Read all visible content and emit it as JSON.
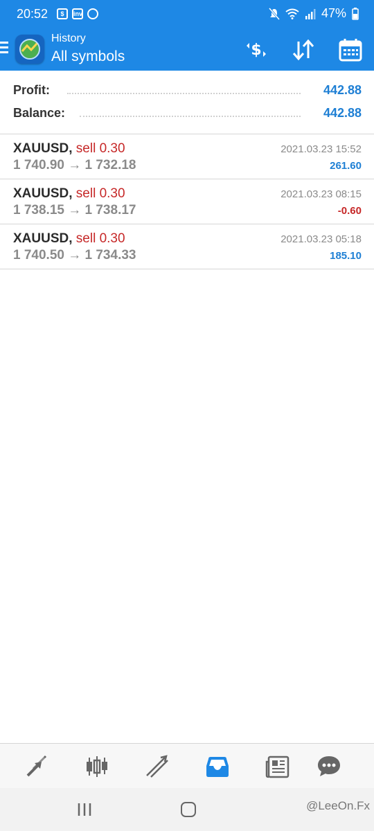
{
  "status_bar": {
    "time": "20:52",
    "battery": "47%",
    "notification_icons": [
      "shopee-icon",
      "investing-icon",
      "whatsapp-icon"
    ],
    "notification_badges": [
      "$",
      "inv",
      ""
    ]
  },
  "app_bar": {
    "subtitle": "History",
    "title": "All symbols",
    "actions": [
      "deposit-swap-icon",
      "sort-icon",
      "calendar-icon"
    ],
    "color": "#1e88e5"
  },
  "summary": {
    "profit_label": "Profit:",
    "profit_value": "442.88",
    "balance_label": "Balance:",
    "balance_value": "442.88"
  },
  "trades": [
    {
      "symbol": "XAUUSD,",
      "side": "sell 0.30",
      "prices": "1 740.90 → 1 732.18",
      "datetime": "2021.03.23 15:52",
      "pl": "261.60"
    },
    {
      "symbol": "XAUUSD,",
      "side": "sell 0.30",
      "prices": "1 738.15 → 1 738.17",
      "datetime": "2021.03.23 08:15",
      "pl": "-0.60"
    },
    {
      "symbol": "XAUUSD,",
      "side": "sell 0.30",
      "prices": "1 740.50 → 1 734.33",
      "datetime": "2021.03.23 05:18",
      "pl": "185.10"
    }
  ],
  "bottom_nav": [
    "quotes-icon",
    "chart-icon",
    "trade-icon",
    "history-icon",
    "news-icon",
    "chat-icon"
  ],
  "bottom_nav_active": "history-icon",
  "colors": {
    "positive": "#1e7fd4",
    "negative": "#c62828",
    "accent": "#1e88e5"
  },
  "watermark": "@LeeOn.Fx"
}
